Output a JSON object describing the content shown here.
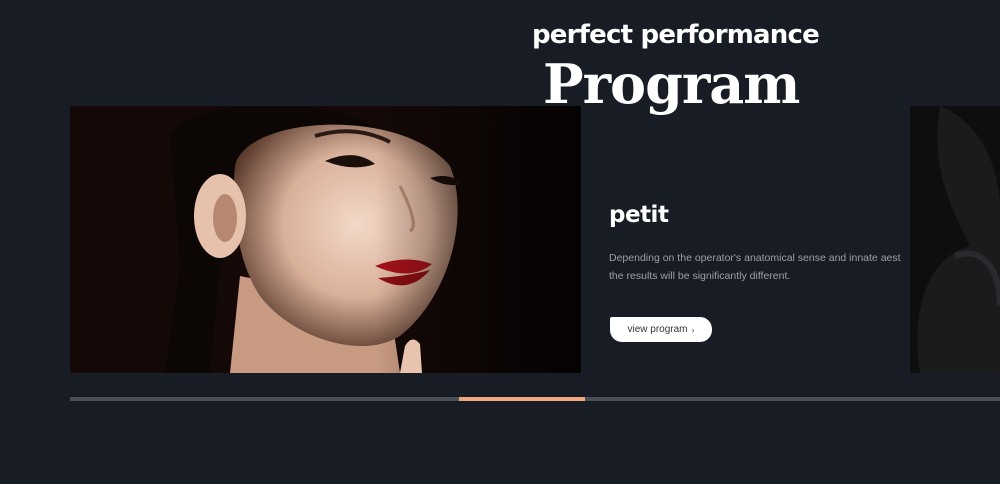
{
  "section": {
    "kicker": "perfect performance",
    "title": "Program"
  },
  "slide": {
    "heading": "petit",
    "description_lines": [
      "Depending on the operator's anatomical sense and innate aest",
      "the results will be significantly different."
    ],
    "button_label": "view program",
    "button_icon": "chevron-right-icon"
  },
  "slider": {
    "active_fraction_start": 0.41,
    "active_fraction_width": 0.135
  },
  "colors": {
    "background": "#181c24",
    "accent": "#f0a87a",
    "track": "#4a4e56"
  }
}
